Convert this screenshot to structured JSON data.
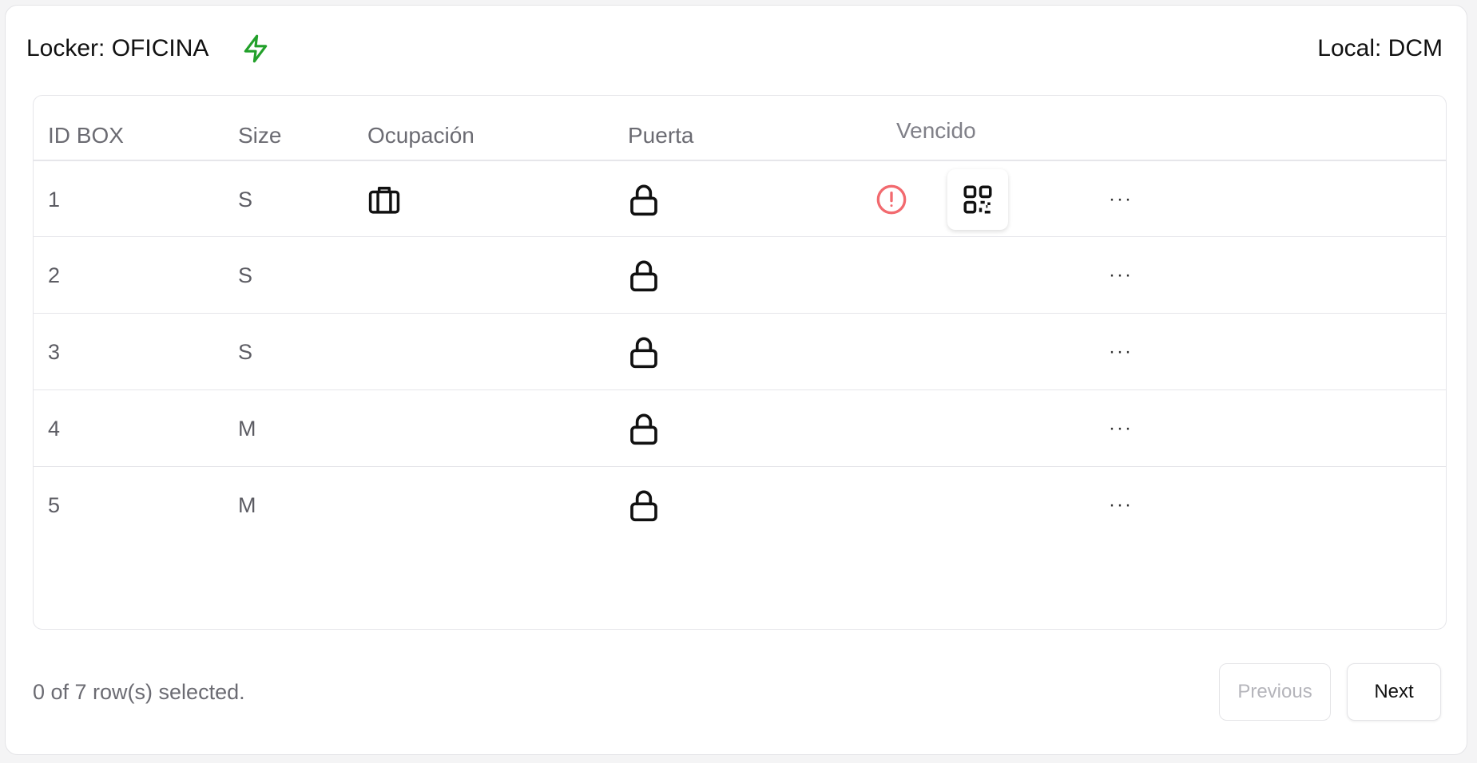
{
  "header": {
    "locker_label": "Locker: OFICINA",
    "status_icon": "zap-icon",
    "status_color": "#22a02a",
    "local_label": "Local: DCM"
  },
  "table": {
    "columns": [
      "ID BOX",
      "Size",
      "Ocupación",
      "Puerta",
      "Vencido"
    ],
    "rows": [
      {
        "id": "1",
        "size": "S",
        "occupied": true,
        "door": "locked",
        "expired": true,
        "has_qr": true
      },
      {
        "id": "2",
        "size": "S",
        "occupied": false,
        "door": "locked",
        "expired": false,
        "has_qr": false
      },
      {
        "id": "3",
        "size": "S",
        "occupied": false,
        "door": "locked",
        "expired": false,
        "has_qr": false
      },
      {
        "id": "4",
        "size": "M",
        "occupied": false,
        "door": "locked",
        "expired": false,
        "has_qr": false
      },
      {
        "id": "5",
        "size": "M",
        "occupied": false,
        "door": "locked",
        "expired": false,
        "has_qr": false
      }
    ],
    "row_actions_label": "···",
    "expired_color": "#f26a6f"
  },
  "footer": {
    "selection_text": "0 of 7 row(s) selected.",
    "previous_label": "Previous",
    "next_label": "Next"
  }
}
